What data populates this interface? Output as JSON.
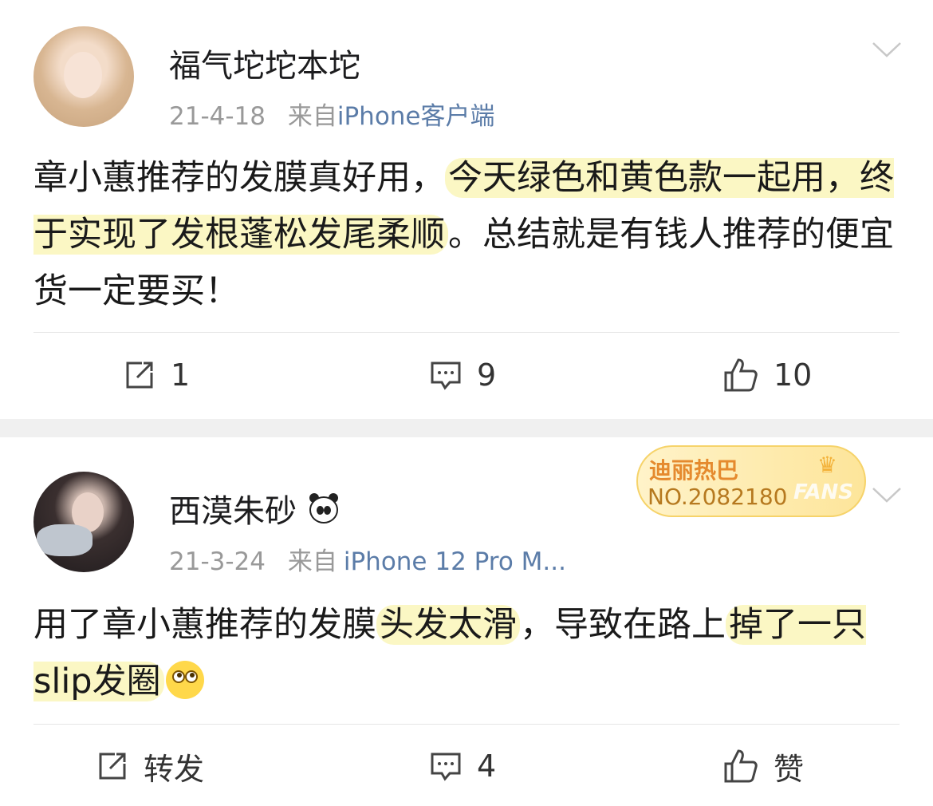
{
  "posts": [
    {
      "username": "福气坨坨本坨",
      "date": "21-4-18",
      "via": "来自",
      "source": "iPhone客户端",
      "text": {
        "part1": "章小蕙推荐的发膜真好用，",
        "highlight1": "今天绿色和黄色款一起用，终于实现了发根蓬松发尾柔顺",
        "part2": "。总结就是有钱人推荐的便宜货一定要买！"
      },
      "actions": {
        "repost": "1",
        "comments": "9",
        "likes": "10"
      }
    },
    {
      "username": "西漠朱砂",
      "username_emoji": "panda-icon",
      "date": "21-3-24",
      "via": "来自",
      "source": "iPhone 12 Pro M...",
      "fan_badge": {
        "name": "迪丽热巴",
        "number": "NO.2082180",
        "tag": "FANS"
      },
      "text": {
        "part1": "用了章小蕙推荐的发膜",
        "highlight1": "头发太滑",
        "part2": "，导致在路上",
        "highlight2": "掉了一只slip发圈",
        "emoji": "eye-roll-emoji"
      },
      "actions": {
        "repost": "转发",
        "comments": "4",
        "likes": "赞"
      }
    }
  ],
  "colors": {
    "source_link": "#5b7ca8",
    "highlight": "#fbf7c4",
    "meta_gray": "#999999",
    "separator": "#f0f0f0"
  }
}
